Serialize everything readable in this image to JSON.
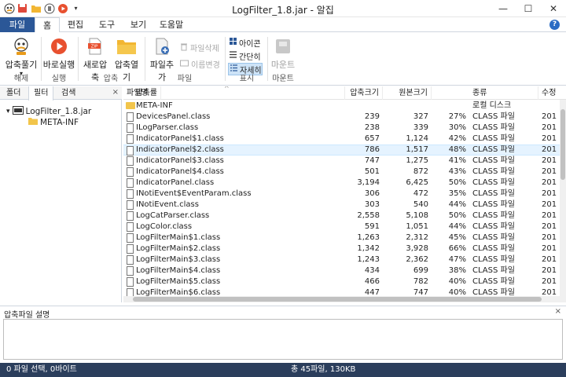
{
  "window": {
    "title": "LogFilter_1.8.jar - 알집",
    "min_icon": "minimize-icon",
    "max_icon": "maximize-icon",
    "close_icon": "close-icon"
  },
  "tabs": [
    {
      "label": "파일"
    },
    {
      "label": "홈"
    },
    {
      "label": "편집"
    },
    {
      "label": "도구"
    },
    {
      "label": "보기"
    },
    {
      "label": "도움말"
    }
  ],
  "help_label": "?",
  "ribbon": {
    "extract": "압축풀기",
    "extract_group": "해제",
    "run": "바로실행",
    "run_group": "실행",
    "new_zip": "새로압축",
    "open_zip": "압축열기",
    "compress_group": "압축",
    "add_file": "파일추가",
    "delete_file": "파일삭제",
    "rename": "이름변경",
    "file_group": "파일",
    "view_icon": "아이콘",
    "view_simple": "간단히",
    "view_detail": "자세히",
    "display_group": "표시",
    "mount": "마운트",
    "mount_group": "마운트",
    "zip_badge": "ZIP"
  },
  "left_panel": {
    "tabs": [
      "폴더",
      "필터",
      "검색"
    ],
    "close": "×",
    "tree": [
      {
        "label": "LogFilter_1.8.jar"
      },
      {
        "label": "META-INF"
      }
    ]
  },
  "file_list": {
    "headers": [
      "파일명",
      "압축크기",
      "원본크기",
      "압축률",
      "종류",
      "수정"
    ],
    "rows": [
      {
        "name": "META-INF",
        "comp": "",
        "orig": "",
        "ratio": "",
        "type": "로컬 디스크",
        "mod": "",
        "folder": true
      },
      {
        "name": "DevicesPanel.class",
        "comp": "239",
        "orig": "327",
        "ratio": "27%",
        "type": "CLASS 파일",
        "mod": "201"
      },
      {
        "name": "ILogParser.class",
        "comp": "238",
        "orig": "339",
        "ratio": "30%",
        "type": "CLASS 파일",
        "mod": "201"
      },
      {
        "name": "IndicatorPanel$1.class",
        "comp": "657",
        "orig": "1,124",
        "ratio": "42%",
        "type": "CLASS 파일",
        "mod": "201"
      },
      {
        "name": "IndicatorPanel$2.class",
        "comp": "786",
        "orig": "1,517",
        "ratio": "48%",
        "type": "CLASS 파일",
        "mod": "201",
        "highlight": true
      },
      {
        "name": "IndicatorPanel$3.class",
        "comp": "747",
        "orig": "1,275",
        "ratio": "41%",
        "type": "CLASS 파일",
        "mod": "201"
      },
      {
        "name": "IndicatorPanel$4.class",
        "comp": "501",
        "orig": "872",
        "ratio": "43%",
        "type": "CLASS 파일",
        "mod": "201"
      },
      {
        "name": "IndicatorPanel.class",
        "comp": "3,194",
        "orig": "6,425",
        "ratio": "50%",
        "type": "CLASS 파일",
        "mod": "201"
      },
      {
        "name": "INotiEvent$EventParam.class",
        "comp": "306",
        "orig": "472",
        "ratio": "35%",
        "type": "CLASS 파일",
        "mod": "201"
      },
      {
        "name": "INotiEvent.class",
        "comp": "303",
        "orig": "540",
        "ratio": "44%",
        "type": "CLASS 파일",
        "mod": "201"
      },
      {
        "name": "LogCatParser.class",
        "comp": "2,558",
        "orig": "5,108",
        "ratio": "50%",
        "type": "CLASS 파일",
        "mod": "201"
      },
      {
        "name": "LogColor.class",
        "comp": "591",
        "orig": "1,051",
        "ratio": "44%",
        "type": "CLASS 파일",
        "mod": "201"
      },
      {
        "name": "LogFilterMain$1.class",
        "comp": "1,263",
        "orig": "2,312",
        "ratio": "45%",
        "type": "CLASS 파일",
        "mod": "201"
      },
      {
        "name": "LogFilterMain$2.class",
        "comp": "1,342",
        "orig": "3,928",
        "ratio": "66%",
        "type": "CLASS 파일",
        "mod": "201"
      },
      {
        "name": "LogFilterMain$3.class",
        "comp": "1,243",
        "orig": "2,362",
        "ratio": "47%",
        "type": "CLASS 파일",
        "mod": "201"
      },
      {
        "name": "LogFilterMain$4.class",
        "comp": "434",
        "orig": "699",
        "ratio": "38%",
        "type": "CLASS 파일",
        "mod": "201"
      },
      {
        "name": "LogFilterMain$5.class",
        "comp": "466",
        "orig": "782",
        "ratio": "40%",
        "type": "CLASS 파일",
        "mod": "201"
      },
      {
        "name": "LogFilterMain$6.class",
        "comp": "447",
        "orig": "747",
        "ratio": "40%",
        "type": "CLASS 파일",
        "mod": "201"
      }
    ]
  },
  "description": {
    "title": "압축파일 설명",
    "close": "×"
  },
  "status": {
    "left": "0 파일 선택,  0바이트",
    "middle": "총 45파일,  130KB"
  },
  "colors": {
    "file_tab_bg": "#2b5797",
    "status_bg": "#2b3e5c",
    "highlight_row": "#e5f3ff",
    "selected_view": "#cde3f7"
  }
}
